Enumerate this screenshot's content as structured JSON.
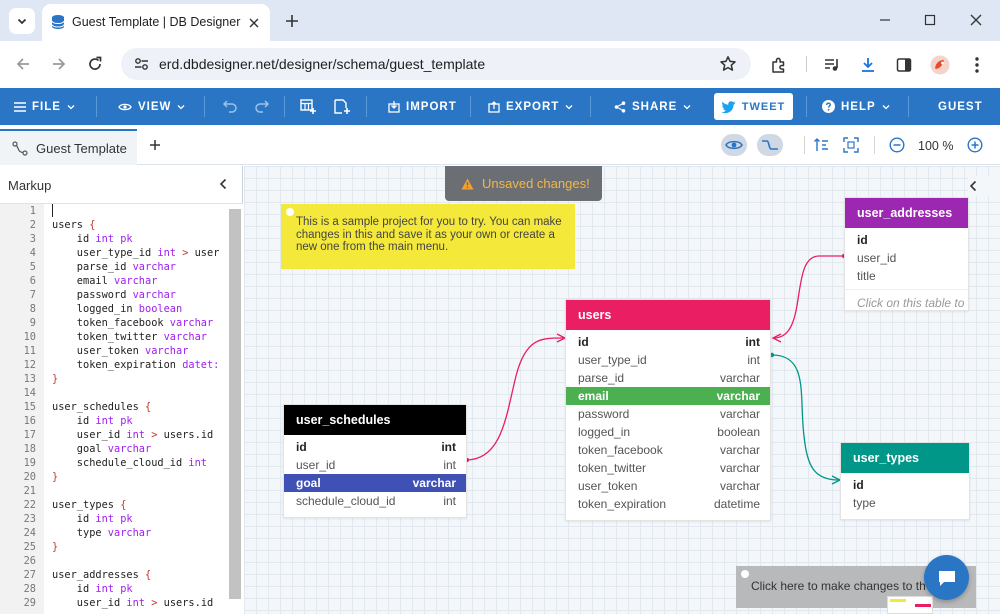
{
  "browser": {
    "tab_title": "Guest Template | DB Designer",
    "url": "erd.dbdesigner.net/designer/schema/guest_template"
  },
  "menubar": {
    "file": "FILE",
    "view": "VIEW",
    "import": "IMPORT",
    "export": "EXPORT",
    "share": "SHARE",
    "tweet": "TWEET",
    "help": "HELP",
    "guest": "GUEST"
  },
  "tabs": {
    "doc_tab": "Guest Template",
    "zoom": "100 %"
  },
  "markup": {
    "title": "Markup",
    "lines": [
      [
        ""
      ],
      [
        [
          "users",
          "t"
        ],
        [
          " {",
          "b"
        ]
      ],
      [
        [
          "    id ",
          "t"
        ],
        [
          "int",
          "k"
        ],
        [
          " pk",
          "k"
        ]
      ],
      [
        [
          "    user_type_id ",
          "t"
        ],
        [
          "int",
          "k"
        ],
        [
          " > ",
          "b"
        ],
        [
          "user",
          "t"
        ]
      ],
      [
        [
          "    parse_id ",
          "t"
        ],
        [
          "varchar",
          "k"
        ]
      ],
      [
        [
          "    email ",
          "t"
        ],
        [
          "varchar",
          "k"
        ]
      ],
      [
        [
          "    password ",
          "t"
        ],
        [
          "varchar",
          "k"
        ]
      ],
      [
        [
          "    logged_in ",
          "t"
        ],
        [
          "boolean",
          "k"
        ]
      ],
      [
        [
          "    token_facebook ",
          "t"
        ],
        [
          "varchar",
          "k"
        ]
      ],
      [
        [
          "    token_twitter ",
          "t"
        ],
        [
          "varchar",
          "k"
        ]
      ],
      [
        [
          "    user_token ",
          "t"
        ],
        [
          "varchar",
          "k"
        ]
      ],
      [
        [
          "    token_expiration ",
          "t"
        ],
        [
          "datet:",
          "k"
        ]
      ],
      [
        [
          "}",
          "b"
        ]
      ],
      [
        ""
      ],
      [
        [
          "user_schedules",
          "t"
        ],
        [
          " {",
          "b"
        ]
      ],
      [
        [
          "    id ",
          "t"
        ],
        [
          "int",
          "k"
        ],
        [
          " pk",
          "k"
        ]
      ],
      [
        [
          "    user_id ",
          "t"
        ],
        [
          "int",
          "k"
        ],
        [
          " > ",
          "b"
        ],
        [
          "users.id",
          "t"
        ]
      ],
      [
        [
          "    goal ",
          "t"
        ],
        [
          "varchar",
          "k"
        ]
      ],
      [
        [
          "    schedule_cloud_id ",
          "t"
        ],
        [
          "int",
          "k"
        ]
      ],
      [
        [
          "}",
          "b"
        ]
      ],
      [
        ""
      ],
      [
        [
          "user_types",
          "t"
        ],
        [
          " {",
          "b"
        ]
      ],
      [
        [
          "    id ",
          "t"
        ],
        [
          "int",
          "k"
        ],
        [
          " pk",
          "k"
        ]
      ],
      [
        [
          "    type ",
          "t"
        ],
        [
          "varchar",
          "k"
        ]
      ],
      [
        [
          "}",
          "b"
        ]
      ],
      [
        ""
      ],
      [
        [
          "user_addresses",
          "t"
        ],
        [
          " {",
          "b"
        ]
      ],
      [
        [
          "    id ",
          "t"
        ],
        [
          "int",
          "k"
        ],
        [
          " pk",
          "k"
        ]
      ],
      [
        [
          "    user_id ",
          "t"
        ],
        [
          "int",
          "k"
        ],
        [
          " > ",
          "b"
        ],
        [
          "users.id",
          "t"
        ]
      ]
    ]
  },
  "canvas": {
    "unsaved": "Unsaved changes!",
    "sample_note": "This is a sample project for you to try. You can make changes in this and save it as your own or create a new one from the main menu.",
    "bottom_note": "Click here to make changes to th",
    "tables": {
      "users": {
        "name": "users",
        "color": "#e91e63",
        "rows": [
          {
            "n": "id",
            "t": "int",
            "s": "pk"
          },
          {
            "n": "user_type_id",
            "t": "int",
            "s": ""
          },
          {
            "n": "parse_id",
            "t": "varchar",
            "s": ""
          },
          {
            "n": "email",
            "t": "varchar",
            "s": "sel"
          },
          {
            "n": "password",
            "t": "varchar",
            "s": ""
          },
          {
            "n": "logged_in",
            "t": "boolean",
            "s": ""
          },
          {
            "n": "token_facebook",
            "t": "varchar",
            "s": ""
          },
          {
            "n": "token_twitter",
            "t": "varchar",
            "s": ""
          },
          {
            "n": "user_token",
            "t": "varchar",
            "s": ""
          },
          {
            "n": "token_expiration",
            "t": "datetime",
            "s": ""
          }
        ],
        "sel_color": "#4caf50"
      },
      "user_schedules": {
        "name": "user_schedules",
        "color": "#000000",
        "rows": [
          {
            "n": "id",
            "t": "int",
            "s": "pk"
          },
          {
            "n": "user_id",
            "t": "int",
            "s": ""
          },
          {
            "n": "goal",
            "t": "varchar",
            "s": "sel"
          },
          {
            "n": "schedule_cloud_id",
            "t": "int",
            "s": ""
          }
        ],
        "sel_color": "#3f51b5"
      },
      "user_addresses": {
        "name": "user_addresses",
        "color": "#9c27b0",
        "rows": [
          {
            "n": "id",
            "t": "",
            "s": "pk"
          },
          {
            "n": "user_id",
            "t": "",
            "s": ""
          },
          {
            "n": "title",
            "t": "",
            "s": ""
          }
        ],
        "hint": "Click on this table to"
      },
      "user_types": {
        "name": "user_types",
        "color": "#009688",
        "rows": [
          {
            "n": "id",
            "t": "",
            "s": "pk"
          },
          {
            "n": "type",
            "t": "",
            "s": ""
          }
        ]
      }
    }
  }
}
